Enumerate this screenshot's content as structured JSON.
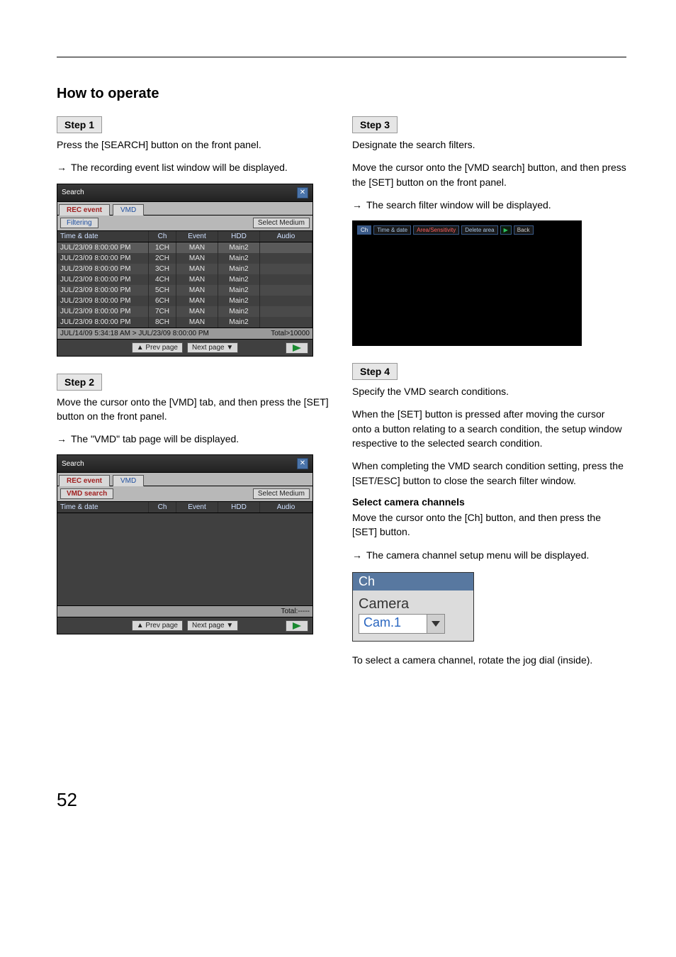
{
  "page_number": "52",
  "title": "How to operate",
  "step1": {
    "label": "Step 1",
    "text": "Press the [SEARCH] button on the front panel.",
    "result": "The recording event list window will be displayed.",
    "window": {
      "title": "Search",
      "tabs": {
        "rec": "REC event",
        "vmd": "VMD"
      },
      "filtering_label": "Filtering",
      "select_medium": "Select Medium",
      "headers": {
        "td": "Time & date",
        "ch": "Ch",
        "ev": "Event",
        "hdd": "HDD",
        "au": "Audio"
      },
      "rows": [
        {
          "td": "JUL/23/09  8:00:00 PM",
          "ch": "1CH",
          "ev": "MAN",
          "hdd": "Main2"
        },
        {
          "td": "JUL/23/09  8:00:00 PM",
          "ch": "2CH",
          "ev": "MAN",
          "hdd": "Main2"
        },
        {
          "td": "JUL/23/09  8:00:00 PM",
          "ch": "3CH",
          "ev": "MAN",
          "hdd": "Main2"
        },
        {
          "td": "JUL/23/09  8:00:00 PM",
          "ch": "4CH",
          "ev": "MAN",
          "hdd": "Main2"
        },
        {
          "td": "JUL/23/09  8:00:00 PM",
          "ch": "5CH",
          "ev": "MAN",
          "hdd": "Main2"
        },
        {
          "td": "JUL/23/09  8:00:00 PM",
          "ch": "6CH",
          "ev": "MAN",
          "hdd": "Main2"
        },
        {
          "td": "JUL/23/09  8:00:00 PM",
          "ch": "7CH",
          "ev": "MAN",
          "hdd": "Main2"
        },
        {
          "td": "JUL/23/09  8:00:00 PM",
          "ch": "8CH",
          "ev": "MAN",
          "hdd": "Main2"
        }
      ],
      "summary_left": "JUL/14/09  5:34:18 AM > JUL/23/09  8:00:00 PM",
      "summary_right": "Total>10000",
      "prev": "▲ Prev page",
      "next": "Next page ▼"
    }
  },
  "step2": {
    "label": "Step 2",
    "text": "Move the cursor onto the [VMD] tab, and then press the [SET] button on the front panel.",
    "result": "The \"VMD\" tab page will be displayed.",
    "window": {
      "title": "Search",
      "tabs": {
        "rec": "REC event",
        "vmd": "VMD"
      },
      "vmd_search_label": "VMD search",
      "select_medium": "Select Medium",
      "headers": {
        "td": "Time & date",
        "ch": "Ch",
        "ev": "Event",
        "hdd": "HDD",
        "au": "Audio"
      },
      "summary_right": "Total:-----",
      "prev": "▲ Prev page",
      "next": "Next page ▼"
    }
  },
  "step3": {
    "label": "Step 3",
    "text1": "Designate the search filters.",
    "text2": "Move the cursor onto the [VMD search] button, and then press the [SET] button on the front panel.",
    "result": "The search filter window will be displayed.",
    "filterbar": {
      "ch": "Ch",
      "td": "Time & date",
      "area": "Area/Sensitivity",
      "del": "Delete area",
      "back": "Back"
    }
  },
  "step4": {
    "label": "Step 4",
    "p1": "Specify the VMD search conditions.",
    "p2": "When the [SET] button is pressed after moving the cursor onto a button relating to a search condition, the setup window respective to the selected search condition.",
    "p3": "When completing the VMD search condition setting, press the [SET/ESC] button to close the search filter window.",
    "subhead": "Select camera channels",
    "p4": "Move the cursor onto the [Ch] button, and then press the [SET] button.",
    "result": "The camera channel setup menu will be displayed.",
    "ch_panel": {
      "head": "Ch",
      "label": "Camera",
      "value": "Cam.1"
    },
    "p5": "To select a camera channel, rotate the jog dial (inside)."
  }
}
